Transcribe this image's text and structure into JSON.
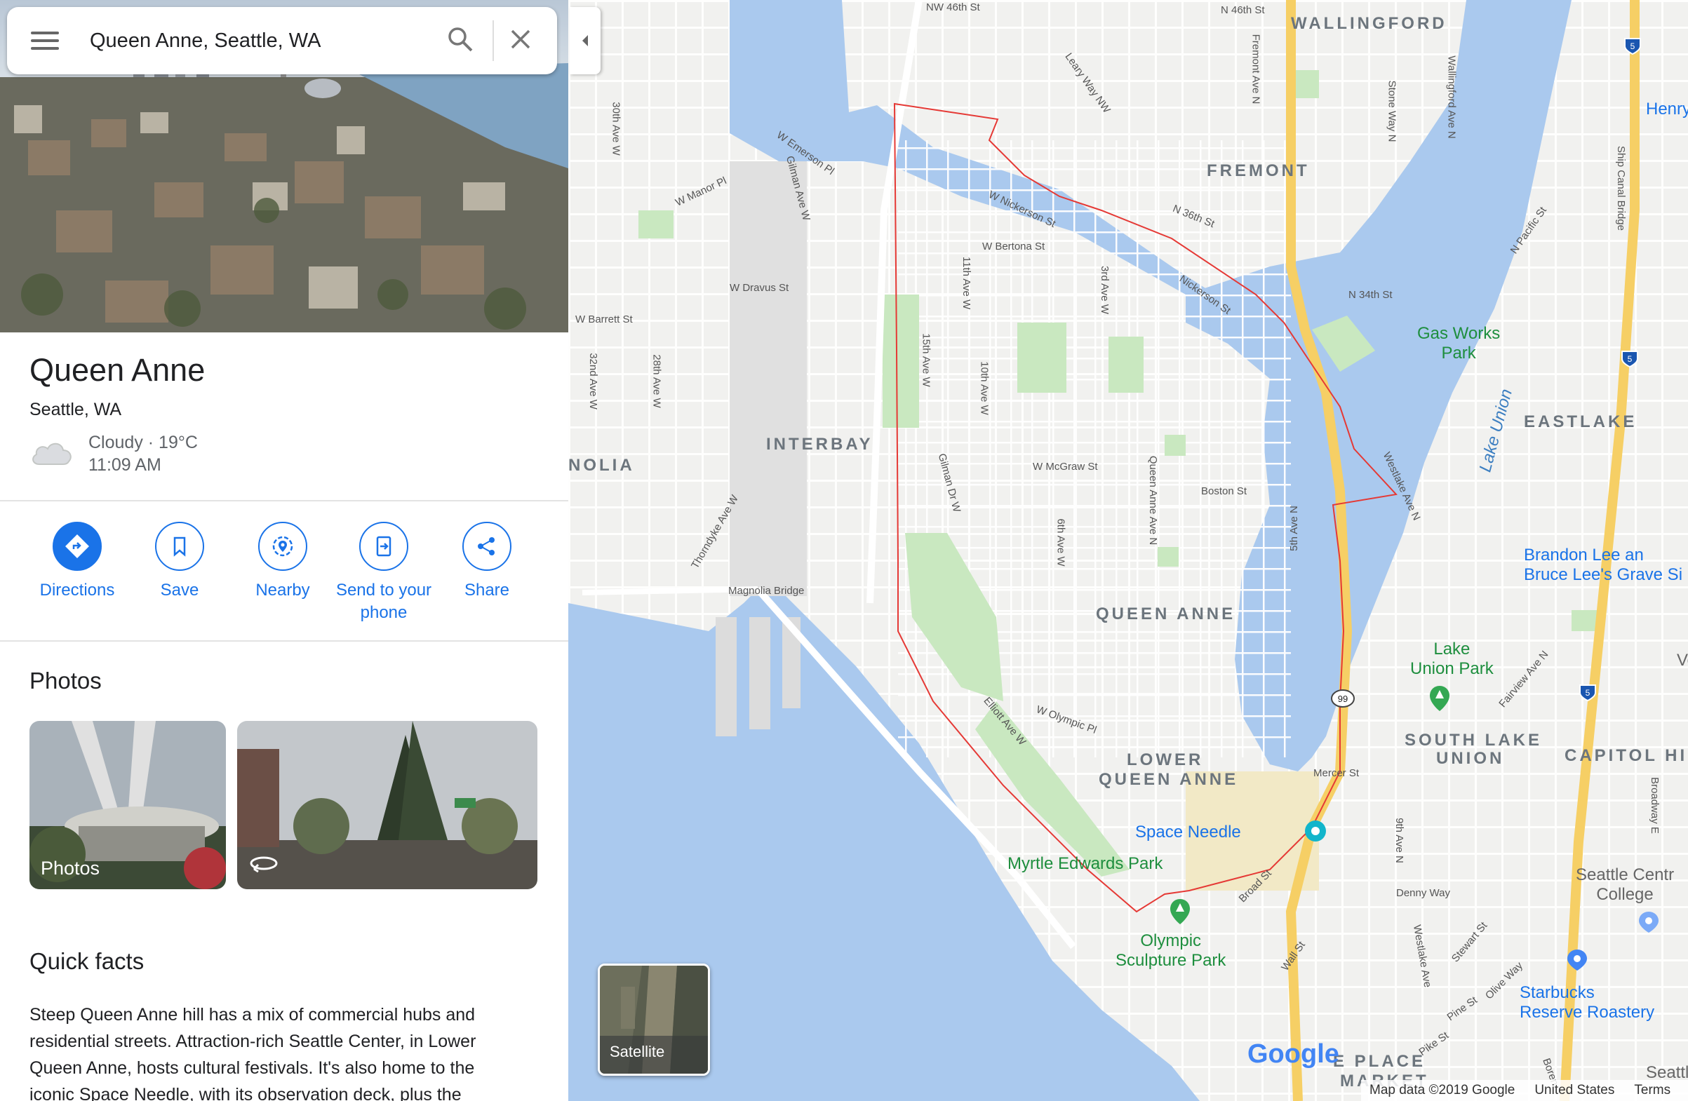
{
  "search": {
    "query": "Queen Anne, Seattle, WA"
  },
  "place": {
    "title": "Queen Anne",
    "subtitle": "Seattle, WA",
    "weather": "Cloudy · 19°C",
    "time": "11:09 AM"
  },
  "actions": [
    {
      "label": "Directions",
      "icon": "directions-icon"
    },
    {
      "label": "Save",
      "icon": "bookmark-icon"
    },
    {
      "label": "Nearby",
      "icon": "nearby-icon"
    },
    {
      "label": "Send to your phone",
      "label_line1": "Send to your",
      "label_line2": "phone",
      "icon": "send-to-phone-icon"
    },
    {
      "label": "Share",
      "icon": "share-icon"
    }
  ],
  "photos": {
    "title": "Photos",
    "tile1_caption": "Photos",
    "tile2_icon": "360-view-icon"
  },
  "quick_facts": {
    "title": "Quick facts",
    "text": "Steep Queen Anne hill has a mix of commercial hubs and residential streets. Attraction-rich Seattle Center, in Lower Queen Anne, hosts cultural festivals. It's also home to the iconic Space Needle, with its observation deck, plus the"
  },
  "map": {
    "colors": {
      "water": "#aac9ee",
      "land": "#f1f1ef",
      "park": "#c9e8c0",
      "highway": "#f6cf65",
      "boundary": "#e53935"
    },
    "neighborhoods": {
      "wallingford": "WALLINGFORD",
      "fremont": "FREMONT",
      "interbay": "INTERBAY",
      "magnolia": "NOLIA",
      "queen_anne": "QUEEN ANNE",
      "lower_queen_anne_1": "LOWER",
      "lower_queen_anne_2": "QUEEN ANNE",
      "eastlake": "EASTLAKE",
      "south_lake_union_1": "SOUTH LAKE",
      "south_lake_union_2": "UNION",
      "capitol_hill": "CAPITOL HILL",
      "pike_place_1": "E PLACE",
      "pike_place_2": "MARKET"
    },
    "streets": {
      "nw46": "NW 46th St",
      "n46": "N 46th St",
      "leary": "Leary Way NW",
      "fremont_ave": "Fremont Ave N",
      "stone_way": "Stone Way N",
      "wallingford_ave": "Wallingford Ave N",
      "w_emerson": "W Emerson Pl",
      "w_manor": "W Manor Pl",
      "gilman_ave": "Gilman Ave W",
      "w_nickerson": "W Nickerson St",
      "n36": "N 36th St",
      "w_bertona": "W Bertona St",
      "w_dravus": "W Dravus St",
      "ave11": "11th Ave W",
      "ave3": "3rd Ave W",
      "nickerson": "Nickerson St",
      "n34": "N 34th St",
      "n_pacific": "N Pacific St",
      "ship_canal": "Ship Canal Bridge",
      "w_barrett": "W Barrett St",
      "ave30": "30th Ave W",
      "ave32": "32nd Ave W",
      "ave28": "28th Ave W",
      "ave15": "15th Ave W",
      "ave10": "10th Ave W",
      "w_mcgraw": "W McGraw St",
      "boston": "Boston St",
      "qa_ave": "Queen Anne Ave N",
      "ave5": "5th Ave N",
      "westlake": "Westlake Ave N",
      "gilman_dr": "Gilman Dr W",
      "ave6": "6th Ave W",
      "thorndyke": "Thorndyke Ave W",
      "magnolia_bridge": "Magnolia Bridge",
      "w_olympic": "W Olympic Pl",
      "elliott": "Elliott Ave W",
      "mercer": "Mercer St",
      "denny": "Denny Way",
      "broad": "Broad St",
      "ave9": "9th Ave N",
      "westlake2": "Westlake Ave",
      "fairview": "Fairview Ave N",
      "broadway": "Broadway E",
      "stewart": "Stewart St",
      "olive": "Olive Way",
      "pine": "Pine St",
      "pike": "Pike St",
      "wall": "Wall St",
      "boren": "Boren"
    },
    "places": {
      "gas_works_1": "Gas Works",
      "gas_works_2": "Park",
      "lake_union": "Lake Union",
      "lake_union_park_1": "Lake",
      "lake_union_park_2": "Union Park",
      "space_needle": "Space Needle",
      "myrtle_edwards": "Myrtle Edwards Park",
      "olympic_1": "Olympic",
      "olympic_2": "Sculpture Park",
      "bruce_lee_1": "Brandon Lee an",
      "bruce_lee_2": "Bruce Lee's Grave Si",
      "henry_art": "Henry A",
      "seattle_central_1": "Seattle Centr",
      "seattle_central_2": "College",
      "starbucks_1": "Starbucks",
      "starbucks_2": "Reserve Roastery",
      "seattle": "Seattle",
      "vol": "Vo"
    },
    "highway_shields": {
      "i5": "5",
      "sr99": "99"
    },
    "satellite_label": "Satellite",
    "footer": {
      "map_data": "Map data ©2019 Google",
      "country": "United States",
      "terms": "Terms"
    },
    "logo": "Google"
  }
}
